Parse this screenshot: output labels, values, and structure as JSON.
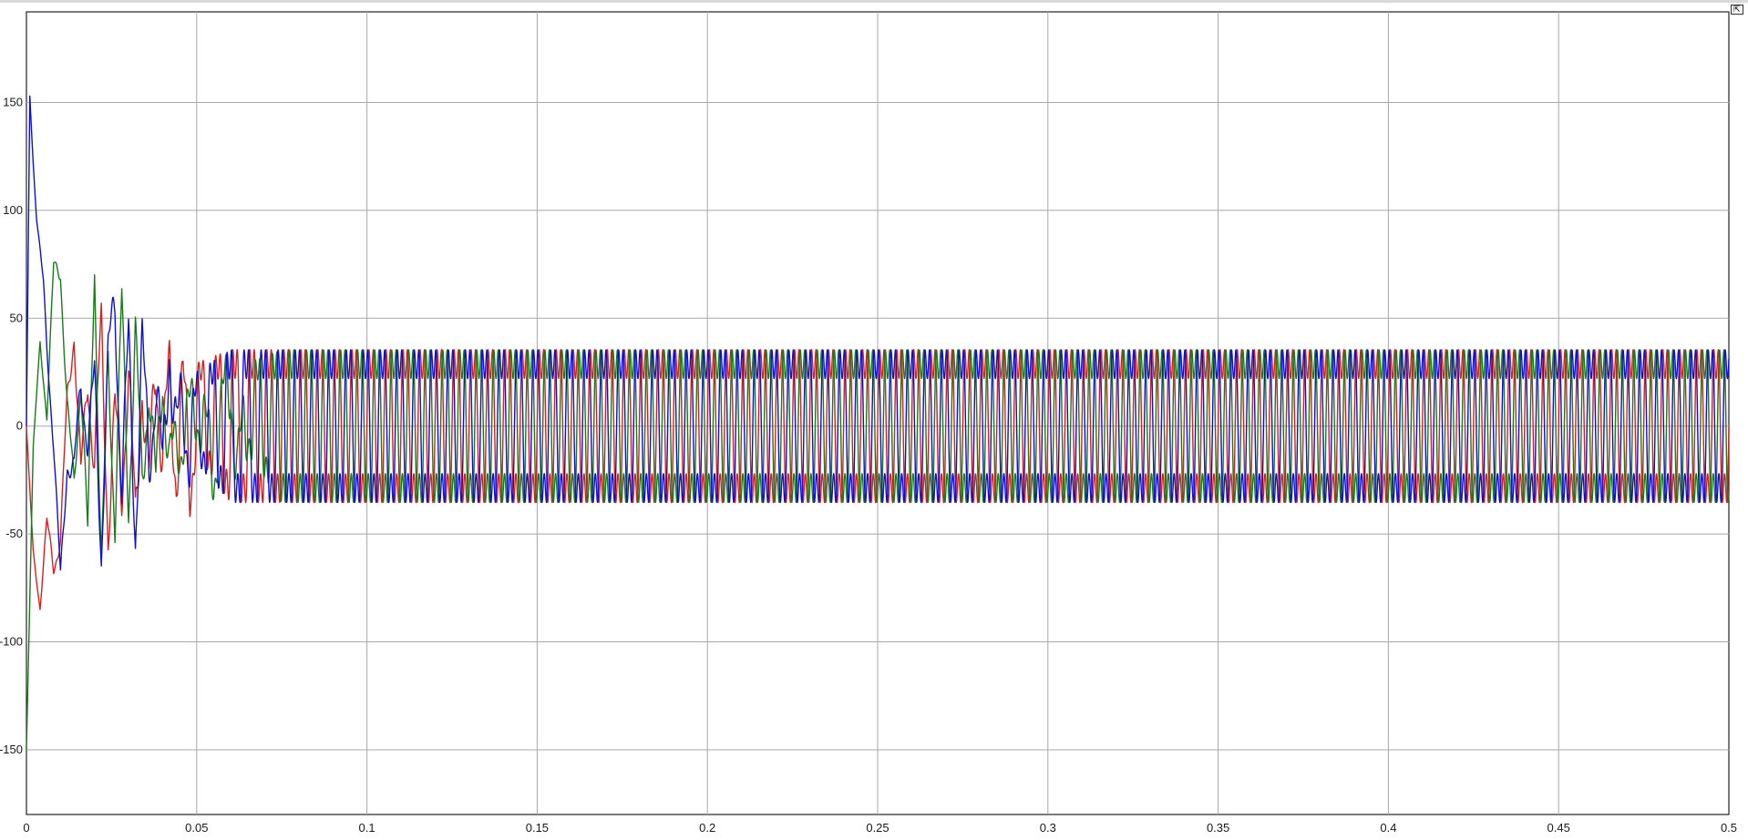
{
  "toolbar": {
    "restore_icon": "restore-window-icon",
    "restore_glyph": "⇱"
  },
  "chart_data": {
    "type": "line",
    "title": "",
    "xlabel": "",
    "ylabel": "",
    "xlim": [
      0,
      0.5
    ],
    "ylim": [
      -180,
      192
    ],
    "grid": true,
    "legend": "none",
    "background": "#ffffff",
    "x_ticks": [
      {
        "value": 0,
        "label": "0"
      },
      {
        "value": 0.05,
        "label": "0.05"
      },
      {
        "value": 0.1,
        "label": "0.1"
      },
      {
        "value": 0.15,
        "label": "0.15"
      },
      {
        "value": 0.2,
        "label": "0.2"
      },
      {
        "value": 0.25,
        "label": "0.25"
      },
      {
        "value": 0.3,
        "label": "0.3"
      },
      {
        "value": 0.35,
        "label": "0.35"
      },
      {
        "value": 0.4,
        "label": "0.4"
      },
      {
        "value": 0.45,
        "label": "0.45"
      },
      {
        "value": 0.5,
        "label": "0.5"
      }
    ],
    "y_ticks": [
      {
        "value": 150,
        "label": "150"
      },
      {
        "value": 100,
        "label": "100"
      },
      {
        "value": 50,
        "label": "50"
      },
      {
        "value": 0,
        "label": "0"
      },
      {
        "value": -50,
        "label": "-50"
      },
      {
        "value": -100,
        "label": "-100"
      },
      {
        "value": -150,
        "label": "-150"
      }
    ],
    "series": [
      {
        "color": "#d62020",
        "phase_deg": 0,
        "steady": {
          "fundamental_hz": 200,
          "fundamental_amp": 36,
          "harmonic_hz": 600,
          "harmonic_amp": 14
        },
        "transient_points": [
          [
            0,
            0
          ],
          [
            0.002,
            -60
          ],
          [
            0.004,
            -88
          ],
          [
            0.006,
            -48
          ],
          [
            0.008,
            -72
          ],
          [
            0.01,
            -60
          ],
          [
            0.012,
            15
          ],
          [
            0.014,
            52
          ],
          [
            0.016,
            -28
          ],
          [
            0.018,
            28
          ],
          [
            0.02,
            -25
          ],
          [
            0.022,
            65
          ],
          [
            0.024,
            -70
          ],
          [
            0.026,
            10
          ],
          [
            0.028,
            -45
          ],
          [
            0.03,
            40
          ],
          [
            0.032,
            -75
          ],
          [
            0.034,
            38
          ],
          [
            0.036,
            -55
          ],
          [
            0.038,
            60
          ],
          [
            0.04,
            -30
          ],
          [
            0.042,
            45
          ],
          [
            0.044,
            -40
          ],
          [
            0.046,
            35
          ],
          [
            0.048,
            -52
          ],
          [
            0.05,
            20
          ]
        ]
      },
      {
        "color": "#1a7a1a",
        "phase_deg": 120,
        "steady": {
          "fundamental_hz": 200,
          "fundamental_amp": 36,
          "harmonic_hz": 600,
          "harmonic_amp": 14
        },
        "transient_points": [
          [
            0,
            -150
          ],
          [
            0.002,
            -10
          ],
          [
            0.004,
            40
          ],
          [
            0.006,
            5
          ],
          [
            0.008,
            80
          ],
          [
            0.01,
            78
          ],
          [
            0.012,
            10
          ],
          [
            0.014,
            -30
          ],
          [
            0.016,
            25
          ],
          [
            0.018,
            -60
          ],
          [
            0.02,
            93
          ],
          [
            0.022,
            -85
          ],
          [
            0.024,
            40
          ],
          [
            0.026,
            -60
          ],
          [
            0.028,
            78
          ],
          [
            0.03,
            -50
          ],
          [
            0.032,
            60
          ],
          [
            0.034,
            -40
          ],
          [
            0.036,
            30
          ],
          [
            0.038,
            -45
          ],
          [
            0.04,
            40
          ],
          [
            0.042,
            -30
          ],
          [
            0.05,
            20
          ],
          [
            0.055,
            -35
          ],
          [
            0.06,
            56
          ],
          [
            0.062,
            -58
          ],
          [
            0.065,
            20
          ]
        ]
      },
      {
        "color": "#1010cc",
        "phase_deg": 240,
        "steady": {
          "fundamental_hz": 200,
          "fundamental_amp": 36,
          "harmonic_hz": 600,
          "harmonic_amp": 14
        },
        "transient_points": [
          [
            0,
            0
          ],
          [
            0.001,
            155
          ],
          [
            0.002,
            125
          ],
          [
            0.003,
            100
          ],
          [
            0.004,
            85
          ],
          [
            0.005,
            70
          ],
          [
            0.006,
            40
          ],
          [
            0.008,
            -10
          ],
          [
            0.01,
            -80
          ],
          [
            0.012,
            -20
          ],
          [
            0.014,
            -25
          ],
          [
            0.016,
            25
          ],
          [
            0.018,
            -10
          ],
          [
            0.02,
            30
          ],
          [
            0.022,
            -80
          ],
          [
            0.024,
            45
          ],
          [
            0.026,
            83
          ],
          [
            0.028,
            -40
          ],
          [
            0.03,
            60
          ],
          [
            0.032,
            -78
          ],
          [
            0.034,
            60
          ],
          [
            0.036,
            -30
          ],
          [
            0.038,
            40
          ],
          [
            0.04,
            -50
          ],
          [
            0.042,
            85
          ],
          [
            0.044,
            -20
          ],
          [
            0.046,
            30
          ],
          [
            0.048,
            -25
          ],
          [
            0.05,
            10
          ]
        ]
      }
    ]
  }
}
